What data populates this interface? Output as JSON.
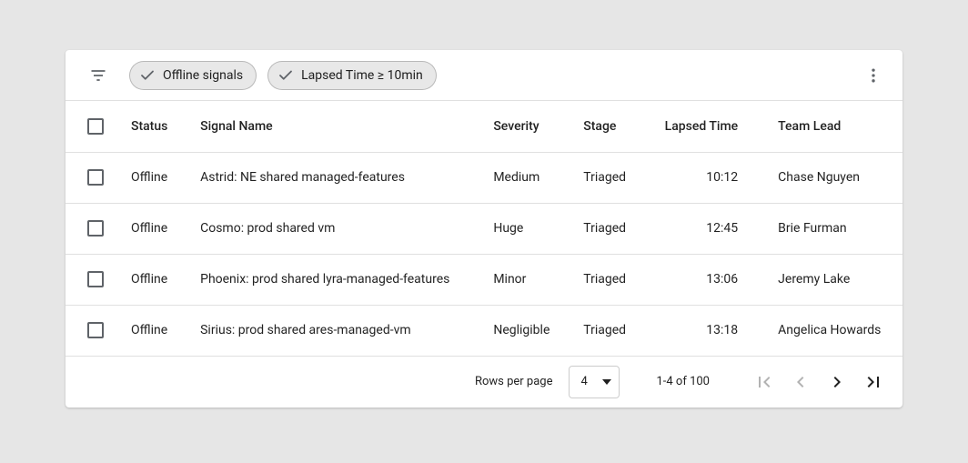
{
  "toolbar": {
    "chips": [
      {
        "label": "Offline signals"
      },
      {
        "label": "Lapsed Time ≥ 10min"
      }
    ]
  },
  "headers": {
    "status": "Status",
    "signal_name": "Signal Name",
    "severity": "Severity",
    "stage": "Stage",
    "lapsed_time": "Lapsed Time",
    "team_lead": "Team Lead"
  },
  "rows": [
    {
      "status": "Offline",
      "signal_name": "Astrid: NE shared managed-features",
      "severity": "Medium",
      "stage": "Triaged",
      "lapsed_time": "10:12",
      "team_lead": "Chase Nguyen"
    },
    {
      "status": "Offline",
      "signal_name": "Cosmo: prod shared vm",
      "severity": "Huge",
      "stage": "Triaged",
      "lapsed_time": "12:45",
      "team_lead": "Brie Furman"
    },
    {
      "status": "Offline",
      "signal_name": "Phoenix: prod shared lyra-managed-features",
      "severity": "Minor",
      "stage": "Triaged",
      "lapsed_time": "13:06",
      "team_lead": "Jeremy Lake"
    },
    {
      "status": "Offline",
      "signal_name": "Sirius: prod shared ares-managed-vm",
      "severity": "Negligible",
      "stage": "Triaged",
      "lapsed_time": "13:18",
      "team_lead": "Angelica Howards"
    }
  ],
  "pagination": {
    "rows_per_page_label": "Rows per page",
    "rows_per_page_value": "4",
    "range": "1-4 of 100"
  }
}
